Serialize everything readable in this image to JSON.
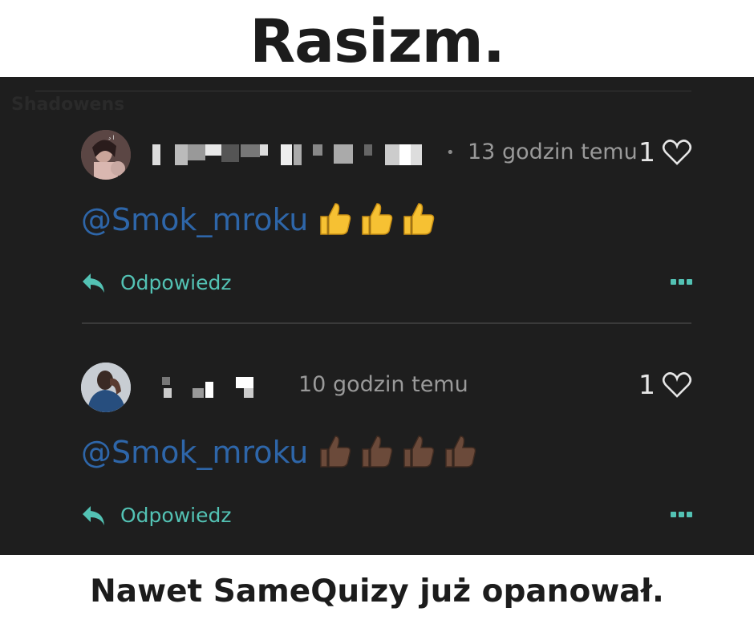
{
  "title": "Rasizm.",
  "caption": "Nawet SameQuizy już opanował.",
  "ghost_text": "Shadowens",
  "comments": [
    {
      "avatar": "avatar-photo",
      "time": "13 godzin temu",
      "likes": "1",
      "mention": "@Smok_mroku",
      "emoji": [
        "thumbs-up-yellow",
        "thumbs-up-yellow",
        "thumbs-up-yellow"
      ],
      "reply_label": "Odpowiedz"
    },
    {
      "avatar": "avatar-photo",
      "time": "10 godzin temu",
      "likes": "1",
      "mention": "@Smok_mroku",
      "emoji": [
        "thumbs-up-dark",
        "thumbs-up-dark",
        "thumbs-up-dark",
        "thumbs-up-dark"
      ],
      "reply_label": "Odpowiedz"
    }
  ],
  "colors": {
    "background": "#1e1e1e",
    "mention": "#2e66a9",
    "accent": "#53c2b4",
    "thumb_yellow": "#f6c133",
    "thumb_dark": "#6b4a3a"
  }
}
